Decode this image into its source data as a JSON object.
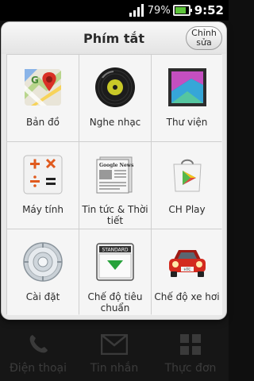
{
  "status_bar": {
    "battery_percent": "79%",
    "battery_level": 0.79,
    "time": "9:52",
    "signal_icon": "signal-icon",
    "battery_icon": "battery-icon"
  },
  "dialog": {
    "title": "Phím tắt",
    "edit_label_line1": "Chỉnh",
    "edit_label_line2": "sửa",
    "shortcuts": [
      {
        "label": "Bản đồ",
        "icon": "maps-icon"
      },
      {
        "label": "Nghe nhạc",
        "icon": "music-disc-icon"
      },
      {
        "label": "Thư viện",
        "icon": "gallery-icon"
      },
      {
        "label": "Máy tính",
        "icon": "calculator-icon"
      },
      {
        "label": "Tin tức & Thời tiết",
        "icon": "news-icon"
      },
      {
        "label": "CH Play",
        "icon": "play-store-icon"
      },
      {
        "label": "Cài đặt",
        "icon": "settings-disc-icon"
      },
      {
        "label": "Chế độ tiêu chuẩn",
        "icon": "standard-mode-icon"
      },
      {
        "label": "Chế độ xe hơi",
        "icon": "car-mode-icon"
      }
    ],
    "standard_icon_text": "STANDARD",
    "news_icon_text": "Google News",
    "car_plate_text": "HTC"
  },
  "dock": [
    {
      "label": "Điện thoại",
      "icon": "phone-icon"
    },
    {
      "label": "Tin nhắn",
      "icon": "message-icon"
    },
    {
      "label": "Thực đơn",
      "icon": "menu-grid-icon"
    }
  ]
}
